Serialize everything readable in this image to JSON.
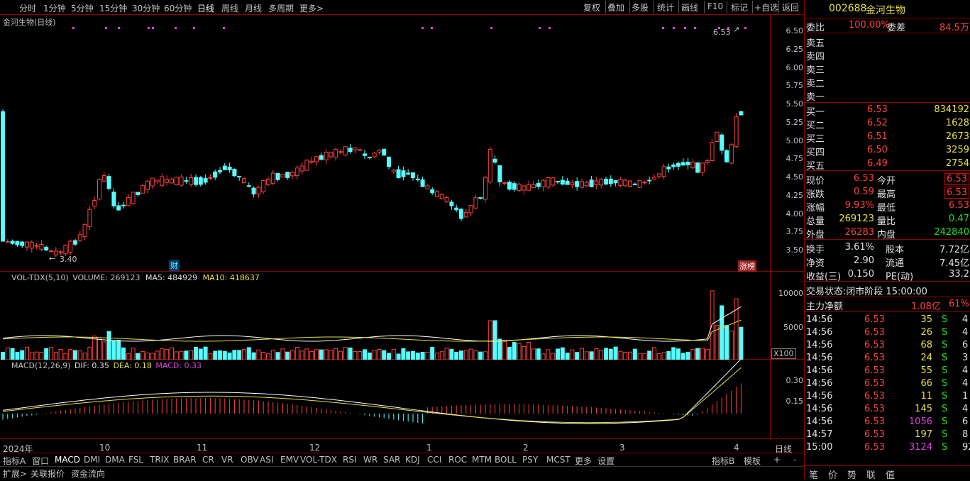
{
  "toolbar": {
    "periods": [
      "分时",
      "1分钟",
      "5分钟",
      "15分钟",
      "30分钟",
      "60分钟",
      "日线",
      "周线",
      "月线",
      "多周期",
      "更多>"
    ],
    "active_period": "日线",
    "tools": [
      "复权",
      "叠加",
      "多股",
      "统计",
      "画线",
      "F10",
      "标记",
      "+自选",
      "返回"
    ]
  },
  "main_chart": {
    "title": "金河生物(日线)",
    "high_label": "6.53",
    "low_label": "3.40",
    "badge_cai": "财",
    "badge_zhangbang": "涨榜",
    "y_ticks": [
      "6.50",
      "6.25",
      "6.00",
      "5.75",
      "5.50",
      "5.25",
      "5.00",
      "4.75",
      "4.50",
      "4.25",
      "4.00",
      "3.75",
      "3.50"
    ]
  },
  "volume_panel": {
    "label": "VOL-TDX(5,10)",
    "volume": "VOLUME: 269123",
    "ma5": "MA5: 484929",
    "ma10": "MA10: 418637",
    "y_ticks": [
      "10000",
      "5000"
    ],
    "unit": "X100"
  },
  "macd_panel": {
    "label": "MACD(12,26,9)",
    "dif": "DIF: 0.35",
    "dea": "DEA: 0.18",
    "macd": "MACD: 0.33",
    "y_ticks": [
      "0.30",
      "0.15"
    ]
  },
  "time_axis": {
    "year": "2024年",
    "months": [
      "10",
      "11",
      "12",
      "1",
      "2",
      "3",
      "4"
    ],
    "period_label": "日线"
  },
  "indicator_tabs": [
    "指标A",
    "窗口",
    "MACD",
    "DMI",
    "DMA",
    "FSL",
    "TRIX",
    "BRAR",
    "CR",
    "VR",
    "OBV",
    "ASI",
    "EMV",
    "VOL-TDX",
    "RSI",
    "WR",
    "SAR",
    "KDJ",
    "CCI",
    "ROC",
    "MTM",
    "BOLL",
    "PSY",
    "MCST",
    "更多",
    "设置"
  ],
  "indicator_right": [
    "指标B",
    "模板",
    "+",
    "-"
  ],
  "bottom_links": [
    "扩展>",
    "关联报价",
    "资金流向"
  ],
  "quote": {
    "code": "002688",
    "name": "金河生物",
    "weibi_label": "委比",
    "weibi": "100.00%",
    "weicha_label": "委差",
    "weicha": "84.5万",
    "sell": [
      {
        "label": "卖五",
        "price": "",
        "vol": ""
      },
      {
        "label": "卖四",
        "price": "",
        "vol": ""
      },
      {
        "label": "卖三",
        "price": "",
        "vol": ""
      },
      {
        "label": "卖二",
        "price": "",
        "vol": ""
      },
      {
        "label": "卖一",
        "price": "",
        "vol": ""
      }
    ],
    "buy": [
      {
        "label": "买一",
        "price": "6.53",
        "vol": "834192"
      },
      {
        "label": "买二",
        "price": "6.52",
        "vol": "1628"
      },
      {
        "label": "买三",
        "price": "6.51",
        "vol": "2673"
      },
      {
        "label": "买四",
        "price": "6.50",
        "vol": "3259"
      },
      {
        "label": "买五",
        "price": "6.49",
        "vol": "2754"
      }
    ],
    "stats": [
      {
        "l1": "现价",
        "v1": "6.53",
        "l2": "今开",
        "v2": "6.53"
      },
      {
        "l1": "涨跌",
        "v1": "0.59",
        "l2": "最高",
        "v2": "6.53"
      },
      {
        "l1": "涨幅",
        "v1": "9.93%",
        "l2": "最低",
        "v2": "6.53"
      },
      {
        "l1": "总量",
        "v1": "269123",
        "l2": "量比",
        "v2": "0.47"
      },
      {
        "l1": "外盘",
        "v1": "26283",
        "l2": "内盘",
        "v2": "242840"
      }
    ],
    "fund": [
      {
        "l1": "换手",
        "v1": "3.61%",
        "l2": "股本",
        "v2": "7.72亿"
      },
      {
        "l1": "净资",
        "v1": "2.90",
        "l2": "流通",
        "v2": "7.45亿"
      },
      {
        "l1": "收益(三)",
        "v1": "0.150",
        "l2": "PE(动)",
        "v2": "33.2"
      }
    ],
    "trade_status": "交易状态:闭市阶段 15:00:00",
    "main_net_label": "主力净额",
    "main_net_value": "1.08亿",
    "main_net_pct": "61%",
    "ticks": [
      {
        "t": "14:56",
        "p": "6.53",
        "v": "35",
        "s": "S",
        "n": "4"
      },
      {
        "t": "14:56",
        "p": "6.53",
        "v": "26",
        "s": "S",
        "n": "4"
      },
      {
        "t": "14:56",
        "p": "6.53",
        "v": "68",
        "s": "S",
        "n": "6"
      },
      {
        "t": "14:56",
        "p": "6.53",
        "v": "24",
        "s": "S",
        "n": "3"
      },
      {
        "t": "14:56",
        "p": "6.53",
        "v": "55",
        "s": "S",
        "n": "4"
      },
      {
        "t": "14:56",
        "p": "6.53",
        "v": "66",
        "s": "S",
        "n": "4"
      },
      {
        "t": "14:56",
        "p": "6.53",
        "v": "11",
        "s": "S",
        "n": "1"
      },
      {
        "t": "14:56",
        "p": "6.53",
        "v": "145",
        "s": "S",
        "n": "4"
      },
      {
        "t": "14:56",
        "p": "6.53",
        "v": "1056",
        "s": "S",
        "n": "6"
      },
      {
        "t": "14:57",
        "p": "6.53",
        "v": "197",
        "s": "S",
        "n": "8"
      },
      {
        "t": "15:00",
        "p": "6.53",
        "v": "3124",
        "s": "S",
        "n": "92"
      }
    ],
    "right_tabs": [
      "笔",
      "价",
      "势",
      "联",
      "值"
    ]
  },
  "colors": {
    "up": "#ff4040",
    "down": "#54ffff",
    "ma5": "#ffffff",
    "ma10": "#e8e040",
    "axis": "#8b0000",
    "macd": "#ff3030"
  }
}
